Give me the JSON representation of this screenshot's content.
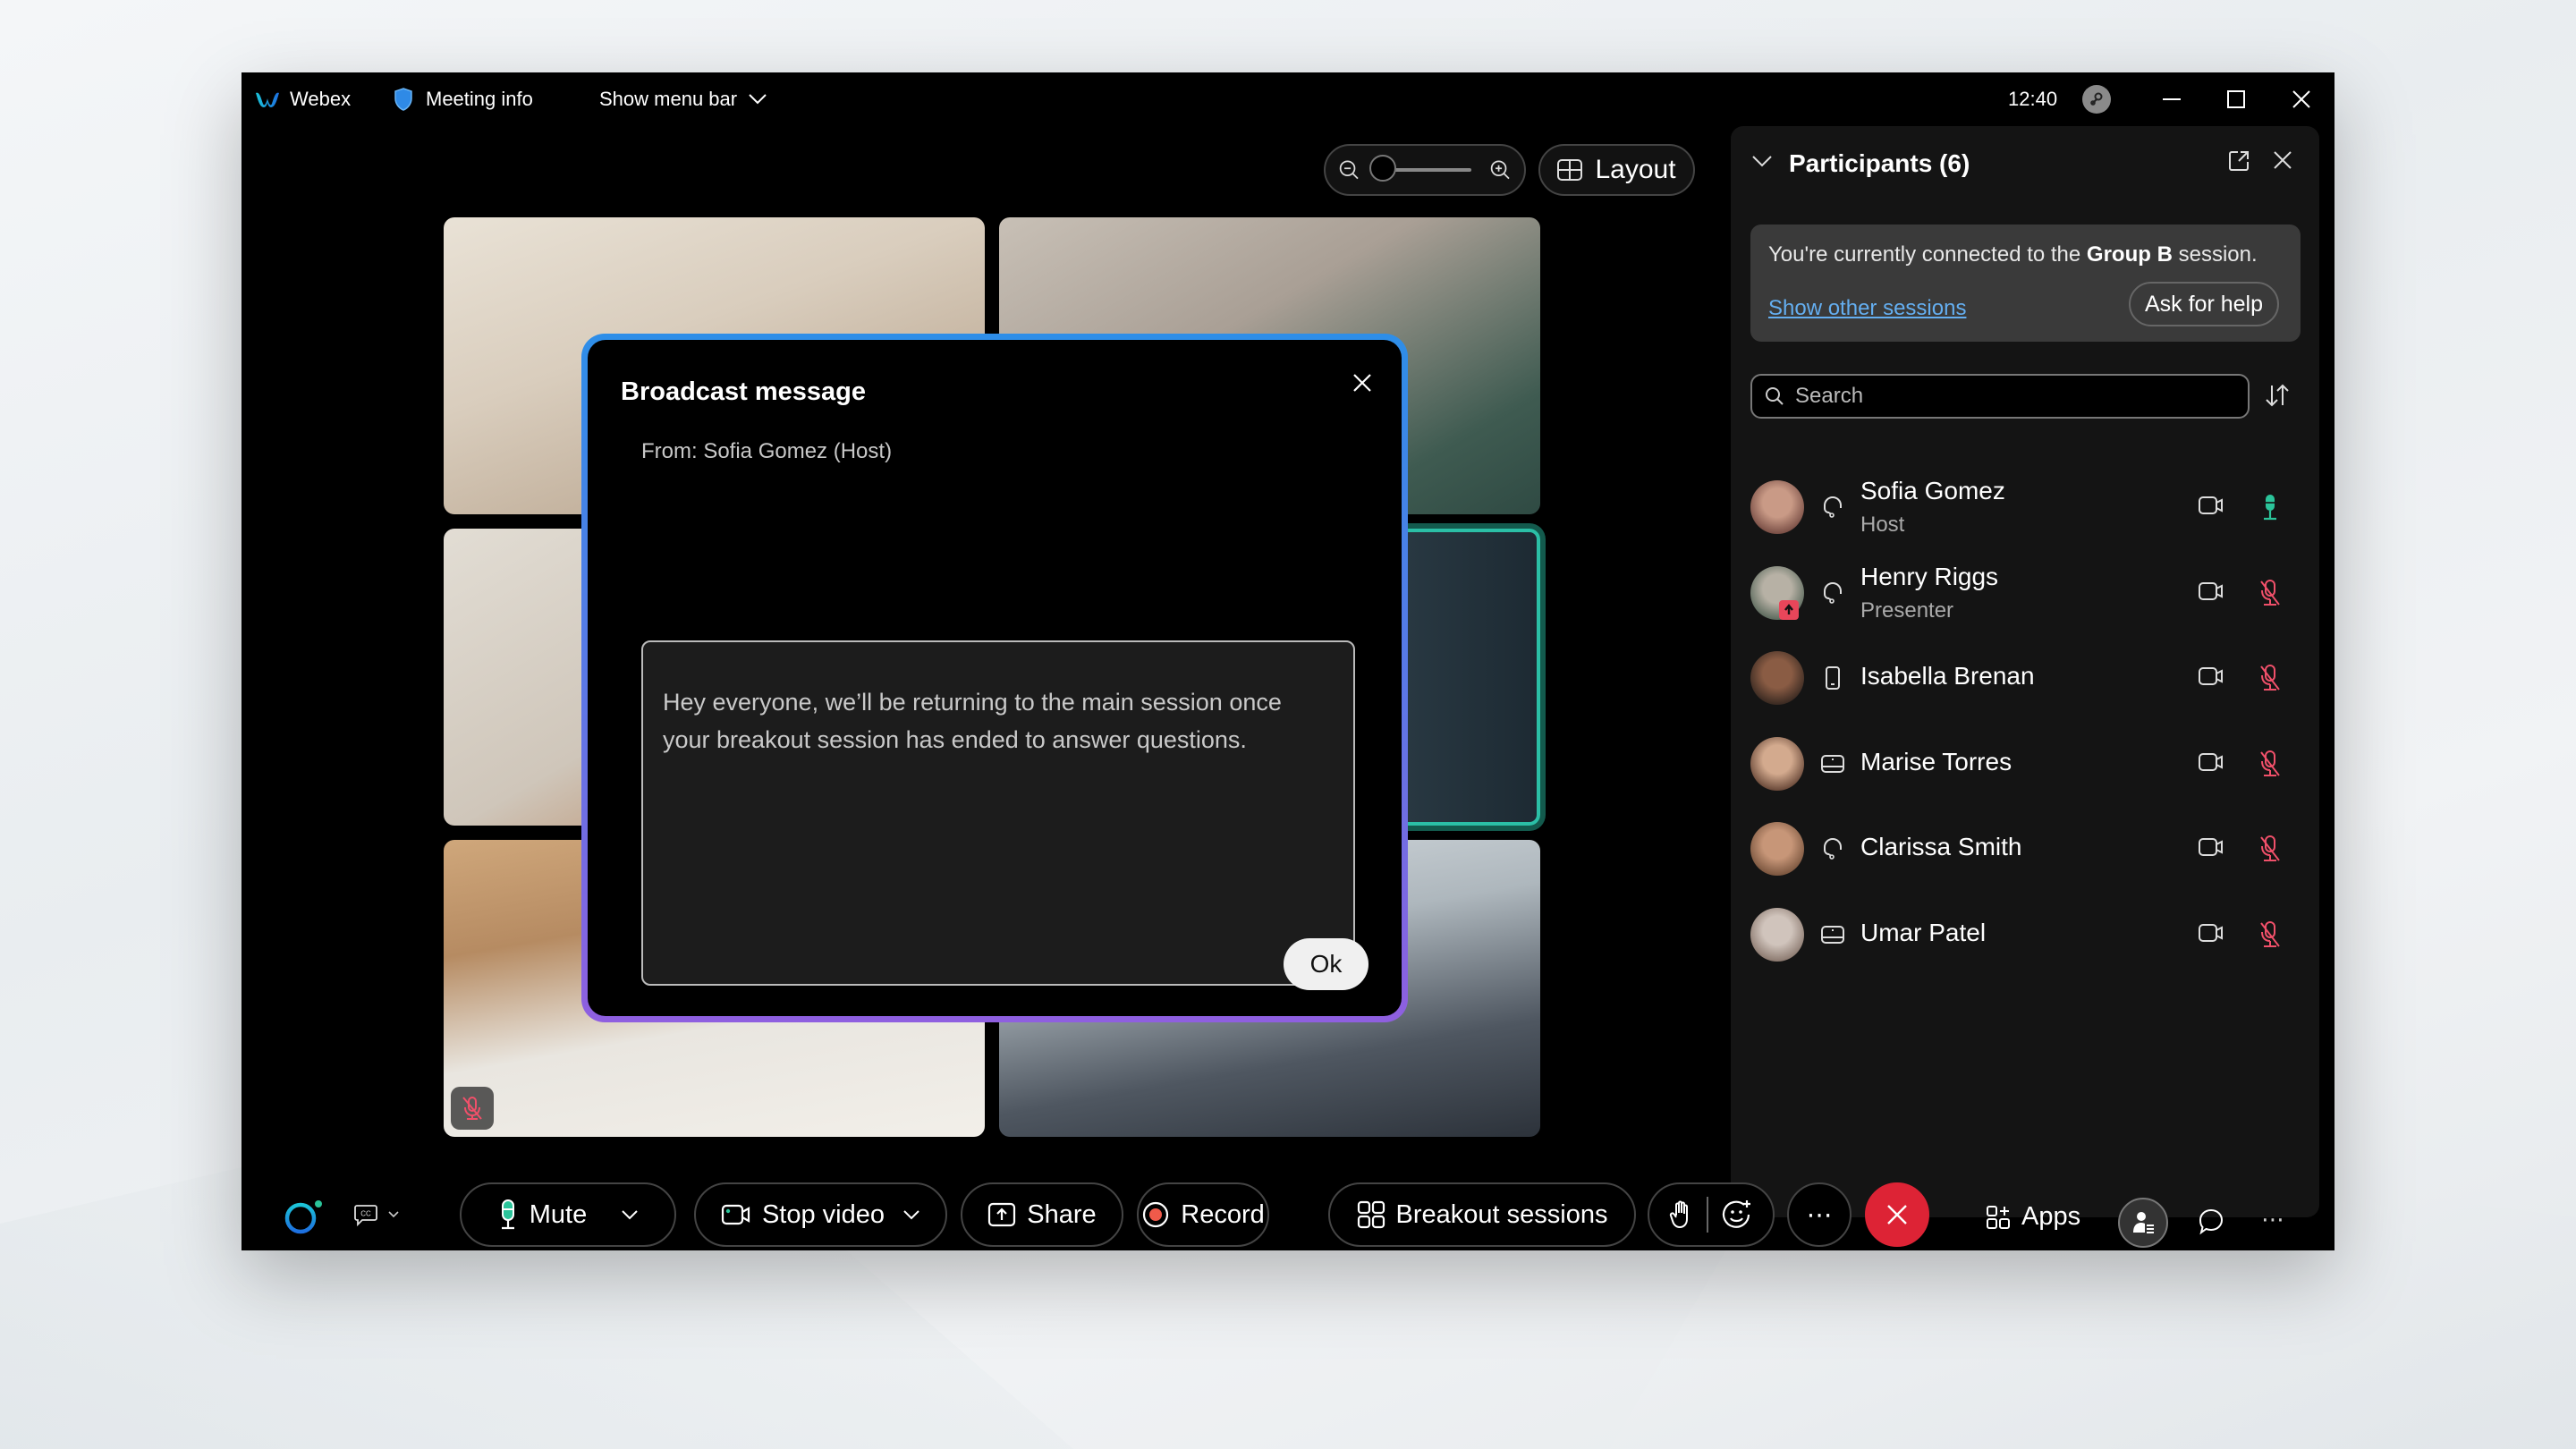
{
  "titlebar": {
    "app_name": "Webex",
    "meeting_info": "Meeting info",
    "show_menu_bar": "Show menu bar",
    "clock": "12:40"
  },
  "stage": {
    "layout_label": "Layout",
    "zoom_level": 0
  },
  "tiles": [
    {
      "name": "tile-1",
      "muted": false
    },
    {
      "name": "tile-2",
      "muted": false
    },
    {
      "name": "tile-3",
      "muted": false
    },
    {
      "name": "tile-4",
      "active_speaker": true
    },
    {
      "name": "tile-5",
      "muted": true
    },
    {
      "name": "tile-6",
      "muted": false
    }
  ],
  "dialog": {
    "title": "Broadcast message",
    "from": "From: Sofia Gomez (Host)",
    "message": "Hey everyone, we’ll be returning to the main session once your breakout session has ended to answer questions.",
    "ok_label": "Ok"
  },
  "panel": {
    "title": "Participants (6)",
    "session_prefix": "You're currently connected to the ",
    "session_name": "Group B",
    "session_suffix": " session.",
    "show_sessions_link": "Show other sessions",
    "ask_help_label": "Ask for help",
    "search_placeholder": "Search",
    "participants": [
      {
        "name": "Sofia Gomez",
        "role": "Host",
        "device": "headset",
        "mic": "unmuted",
        "colors": [
          "#c99a86",
          "#7a4f46"
        ]
      },
      {
        "name": "Henry Riggs",
        "role": "Presenter",
        "device": "headset",
        "mic": "muted",
        "presenter": true,
        "colors": [
          "#b7b1a5",
          "#5d6b5e"
        ]
      },
      {
        "name": "Isabella Brenan",
        "role": "",
        "device": "mobile",
        "mic": "muted",
        "colors": [
          "#8a5c44",
          "#3a2a22"
        ]
      },
      {
        "name": "Marise Torres",
        "role": "",
        "device": "desktop",
        "mic": "muted",
        "colors": [
          "#d3aa8e",
          "#6b4a3a"
        ]
      },
      {
        "name": "Clarissa Smith",
        "role": "",
        "device": "headset",
        "mic": "muted",
        "colors": [
          "#c79678",
          "#7b563f"
        ]
      },
      {
        "name": "Umar Patel",
        "role": "",
        "device": "desktop",
        "mic": "muted",
        "colors": [
          "#d0c4bc",
          "#8c7a70"
        ]
      }
    ]
  },
  "toolbar": {
    "mute_label": "Mute",
    "stop_video_label": "Stop video",
    "share_label": "Share",
    "record_label": "Record",
    "breakout_label": "Breakout sessions",
    "apps_label": "Apps",
    "more_label": "⋯",
    "overflow_label": "⋯"
  },
  "colors": {
    "accent_blue": "#2e8ee8",
    "accent_purple": "#8f5fe0",
    "active_speaker": "#2bbfa6",
    "mic_on": "#2bc49a",
    "mic_off": "#f0506a",
    "end_call": "#dd2335",
    "link": "#64aef0"
  }
}
